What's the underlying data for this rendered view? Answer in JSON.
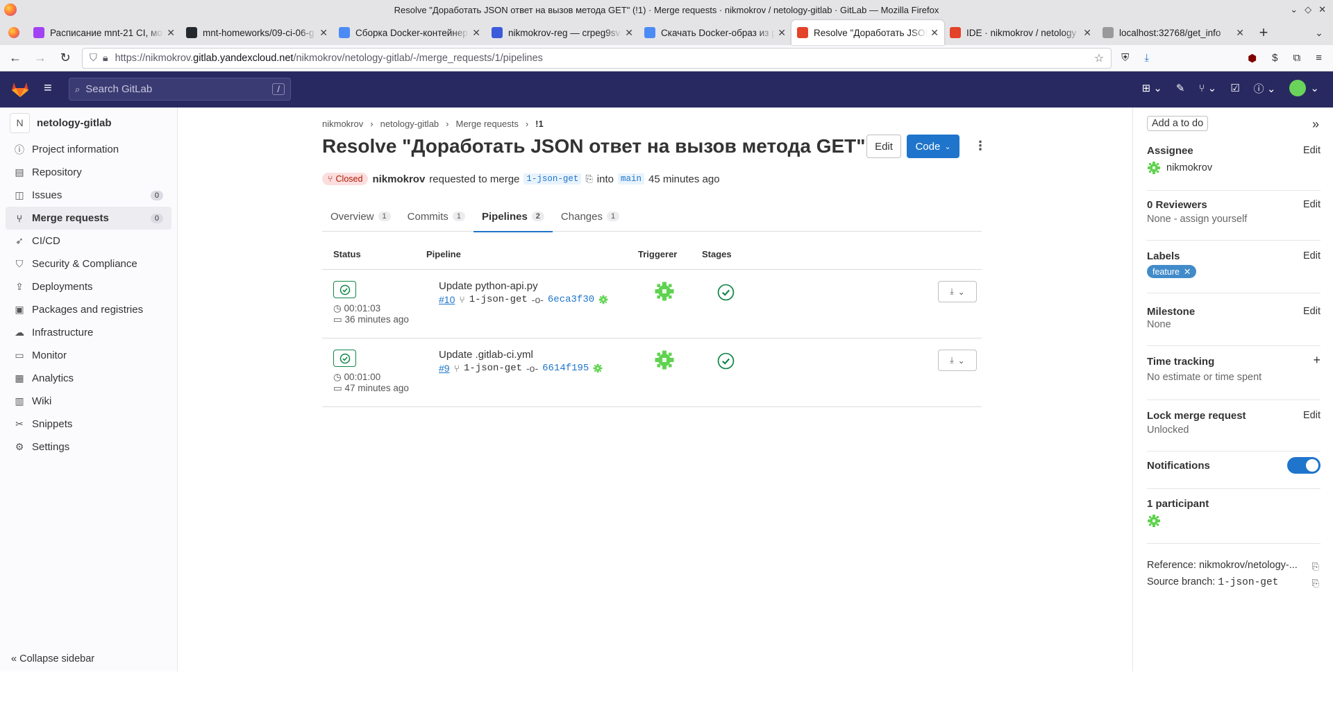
{
  "window": {
    "title": "Resolve \"Доработать JSON ответ на вызов метода GET\" (!1) · Merge requests · nikmokrov / netology-gitlab · GitLab — Mozilla Firefox"
  },
  "tabs": [
    {
      "label": "Расписание mnt-21 CI, мо",
      "color": "#a142f4"
    },
    {
      "label": "mnt-homeworks/09-ci-06-g",
      "color": "#24292f"
    },
    {
      "label": "Сборка Docker-контейнер",
      "color": "#4c8bf5"
    },
    {
      "label": "nikmokrov-reg — crpeg9sv",
      "color": "#3b5bdb"
    },
    {
      "label": "Скачать Docker-образ из р",
      "color": "#4c8bf5"
    },
    {
      "label": "Resolve \"Доработать JSON",
      "color": "#e24329"
    },
    {
      "label": "IDE · nikmokrov / netology",
      "color": "#e24329"
    },
    {
      "label": "localhost:32768/get_info",
      "color": "#999999"
    }
  ],
  "url": {
    "pre": "https://nikmokrov.",
    "domain": "gitlab.yandexcloud.net",
    "post": "/nikmokrov/netology-gitlab/-/merge_requests/1/pipelines"
  },
  "gitlab": {
    "search_placeholder": "Search GitLab",
    "search_kbd": "/"
  },
  "sidebar": {
    "project_initial": "N",
    "project_name": "netology-gitlab",
    "items": [
      {
        "label": "Project information",
        "icon": "info-icon"
      },
      {
        "label": "Repository",
        "icon": "doc-icon"
      },
      {
        "label": "Issues",
        "icon": "issues-icon",
        "count": "0"
      },
      {
        "label": "Merge requests",
        "icon": "merge-icon",
        "count": "0"
      },
      {
        "label": "CI/CD",
        "icon": "rocket-icon"
      },
      {
        "label": "Security & Compliance",
        "icon": "shield-icon"
      },
      {
        "label": "Deployments",
        "icon": "deploy-icon"
      },
      {
        "label": "Packages and registries",
        "icon": "package-icon"
      },
      {
        "label": "Infrastructure",
        "icon": "cloud-icon"
      },
      {
        "label": "Monitor",
        "icon": "monitor-icon"
      },
      {
        "label": "Analytics",
        "icon": "chart-icon"
      },
      {
        "label": "Wiki",
        "icon": "book-icon"
      },
      {
        "label": "Snippets",
        "icon": "scissors-icon"
      },
      {
        "label": "Settings",
        "icon": "gear-icon"
      }
    ],
    "collapse_label": "Collapse sidebar"
  },
  "breadcrumbs": [
    "nikmokrov",
    "netology-gitlab",
    "Merge requests",
    "!1"
  ],
  "mr": {
    "title": "Resolve \"Доработать JSON ответ на вызов метода GET\"",
    "edit_label": "Edit",
    "code_label": "Code",
    "status": "Closed",
    "author": "nikmokrov",
    "requested_text": "requested to merge",
    "source_branch": "1-json-get",
    "into_text": "into",
    "target_branch": "main",
    "time": "45 minutes ago"
  },
  "mr_tabs": [
    {
      "label": "Overview",
      "count": "1"
    },
    {
      "label": "Commits",
      "count": "1"
    },
    {
      "label": "Pipelines",
      "count": "2"
    },
    {
      "label": "Changes",
      "count": "1"
    }
  ],
  "pipelines": {
    "headers": {
      "status": "Status",
      "pipeline": "Pipeline",
      "triggerer": "Triggerer",
      "stages": "Stages"
    },
    "rows": [
      {
        "duration": "00:01:03",
        "ago": "36 minutes ago",
        "name": "Update python-api.py",
        "id": "#10",
        "branch": "1-json-get",
        "sha": "6eca3f30"
      },
      {
        "duration": "00:01:00",
        "ago": "47 minutes ago",
        "name": "Update .gitlab-ci.yml",
        "id": "#9",
        "branch": "1-json-get",
        "sha": "6614f195"
      }
    ]
  },
  "right": {
    "todo_label": "Add a to do",
    "assignee_title": "Assignee",
    "assignee_edit": "Edit",
    "assignee_name": "nikmokrov",
    "reviewers_title": "0 Reviewers",
    "reviewers_edit": "Edit",
    "reviewers_value": "None - assign yourself",
    "labels_title": "Labels",
    "labels_edit": "Edit",
    "label_name": "feature",
    "milestone_title": "Milestone",
    "milestone_edit": "Edit",
    "milestone_value": "None",
    "time_title": "Time tracking",
    "time_value": "No estimate or time spent",
    "lock_title": "Lock merge request",
    "lock_edit": "Edit",
    "lock_value": "Unlocked",
    "notifications_title": "Notifications",
    "participants_title": "1 participant",
    "reference": "Reference: nikmokrov/netology-...",
    "source_label": "Source branch: ",
    "source_value": "1-json-get"
  },
  "colors": {
    "gitlab_nav": "#292961",
    "accent": "#1f75cb",
    "success": "#108548",
    "closed_bg": "#fcdede",
    "label": "#428bca"
  }
}
